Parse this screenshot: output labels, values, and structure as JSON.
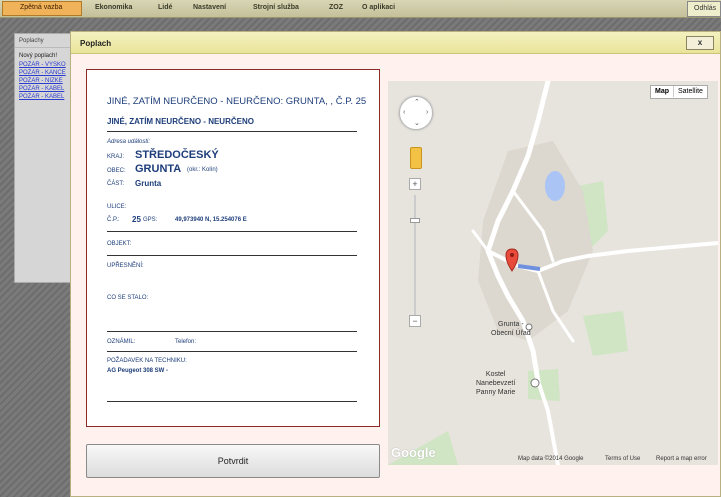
{
  "topbar": {
    "feedback": "Zpětná vazba",
    "menu": [
      "Ekonomika",
      "Lidé",
      "Nastavení",
      "Strojní služba",
      "ZOZ",
      "O aplikaci"
    ],
    "logout": "Odhlás"
  },
  "bgpanel": {
    "title": "Poplachy",
    "subtitle": "Nový poplach!",
    "links": [
      "POŽÁR - VÝŠKO",
      "POŽÁR - KANCE",
      "POŽÁR - NÍZKÉ",
      "POŽÁR - KABEL",
      "POŽÁR - KABEL"
    ]
  },
  "dialog": {
    "title": "Poplach",
    "close": "x",
    "confirm": "Potvrdit"
  },
  "alarm": {
    "title": "JINÉ, ZATÍM NEURČENO - NEURČENO: GRUNTA, , Č.P. 25",
    "subtitle": "JINÉ, ZATÍM NEURČENO - NEURČENO",
    "address_label": "Adresa události:",
    "kraj_label": "KRAJ:",
    "kraj": "STŘEDOČESKÝ",
    "obec_label": "OBEC:",
    "obec": "GRUNTA",
    "okres": "(okr.: Kolín)",
    "cast_label": "ČÁST:",
    "cast": "Grunta",
    "ulice_label": "ULICE:",
    "cp_label": "Č.P.:",
    "cp": "25",
    "gps_label": "GPS:",
    "gps": "49,973940 N, 15.254076 E",
    "objekt_label": "OBJEKT:",
    "upresneni_label": "UPŘESNĚNÍ:",
    "co_se_stalo_label": "CO SE STALO:",
    "oznamil_label": "OZNÁMIL:",
    "telefon_label": "Telefon:",
    "technika_label": "POŽADAVEK NA TECHNIKU:",
    "technika": "AG Peugeot 308 SW -"
  },
  "map": {
    "type_map": "Map",
    "type_satellite": "Satellite",
    "label_obecni_urad": "Grunta -\nObecní Úřad",
    "label_kostel": "Kostel\nNanebevzetí\nPanny Marie",
    "google": "Google",
    "footer_data": "Map data ©2014 Google",
    "footer_terms": "Terms of Use",
    "footer_report": "Report a map error"
  }
}
